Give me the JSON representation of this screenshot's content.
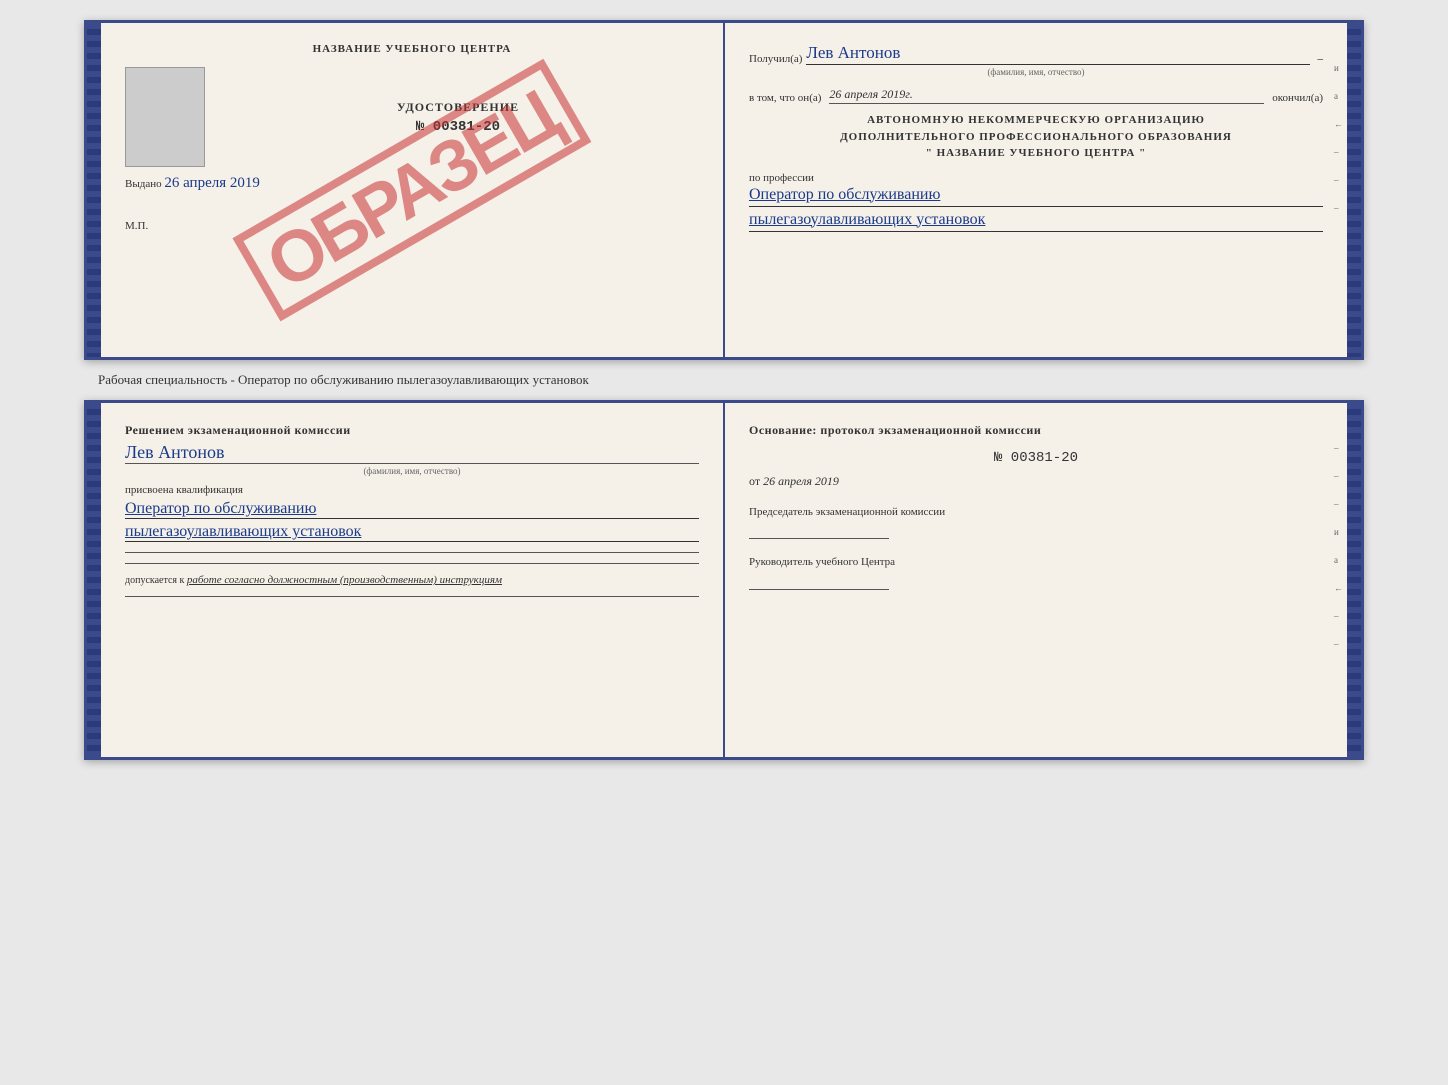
{
  "page": {
    "background_color": "#e8e8e8"
  },
  "subtitle": "Рабочая специальность - Оператор по обслуживанию пылегазоулавливающих установок",
  "top_book": {
    "left_page": {
      "title": "НАЗВАНИЕ УЧЕБНОГО ЦЕНТРА",
      "cert_label": "УДОСТОВЕРЕНИЕ",
      "cert_number": "№ 00381-20",
      "issued_label": "Выдано",
      "issued_date": "26 апреля 2019",
      "stamp_label": "М.П.",
      "obrazets_text": "ОБРАЗЕЦ"
    },
    "right_page": {
      "received_label": "Получил(а)",
      "received_name": "Лев Антонов",
      "fio_hint": "(фамилия, имя, отчество)",
      "in_that_label": "в том, что он(а)",
      "date_value": "26 апреля 2019г.",
      "finished_label": "окончил(а)",
      "org_line1": "АВТОНОМНУЮ НЕКОММЕРЧЕСКУЮ ОРГАНИЗАЦИЮ",
      "org_line2": "ДОПОЛНИТЕЛЬНОГО ПРОФЕССИОНАЛЬНОГО ОБРАЗОВАНИЯ",
      "org_line3": "\"  НАЗВАНИЕ УЧЕБНОГО ЦЕНТРА  \"",
      "profession_label": "по профессии",
      "profession_line1": "Оператор по обслуживанию",
      "profession_line2": "пылегазоулавливающих установок",
      "side_marks": [
        "и",
        "а",
        "←",
        "–",
        "–",
        "–",
        "–",
        "–",
        "–"
      ]
    }
  },
  "bottom_book": {
    "left_page": {
      "commission_text": "Решением экзаменационной комиссии",
      "name_value": "Лев Антонов",
      "fio_hint": "(фамилия, имя, отчество)",
      "assigned_text": "присвоена квалификация",
      "qualification_line1": "Оператор по обслуживанию",
      "qualification_line2": "пылегазоулавливающих установок",
      "допускается_prefix": "допускается к",
      "допускается_value": "работе согласно должностным (производственным) инструкциям"
    },
    "right_page": {
      "osnov_text": "Основание: протокол экзаменационной комиссии",
      "protocol_number": "№  00381-20",
      "protocol_date_prefix": "от",
      "protocol_date": "26 апреля 2019",
      "chairman_label": "Председатель экзаменационной комиссии",
      "director_label": "Руководитель учебного Центра",
      "side_marks": [
        "–",
        "–",
        "–",
        "и",
        "а",
        "←",
        "–",
        "–",
        "–",
        "–"
      ]
    }
  }
}
